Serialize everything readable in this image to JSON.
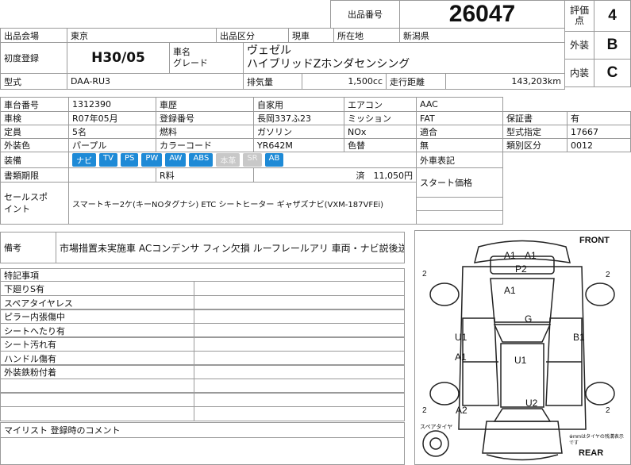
{
  "header": {
    "lot_label": "出品番号",
    "lot_number": "26047",
    "eval_label": "評価点",
    "eval_score": "4",
    "exterior_label": "外装",
    "exterior_grade": "B",
    "interior_label": "内装",
    "interior_grade": "C"
  },
  "row_venue": {
    "venue_label": "出品会場",
    "venue_value": "東京",
    "category_label": "出品区分",
    "category_value": "現車",
    "location_label": "所在地",
    "location_value": "新潟県"
  },
  "row_reg": {
    "first_reg_label": "初度登録",
    "first_reg_value": "H30/05",
    "car_name_label": "車名",
    "grade_label": "グレード",
    "car_name_value": "ヴェゼル",
    "grade_value": "ハイブリッドZホンダセンシング"
  },
  "row_model": {
    "model_label": "型式",
    "model_value": "DAA-RU3",
    "displacement_label": "排気量",
    "displacement_value": "1,500cc",
    "mileage_label": "走行距離",
    "mileage_value": "143,203km"
  },
  "specs": {
    "chassis_label": "車台番号",
    "chassis_value": "1312390",
    "history_label": "車歴",
    "history_value": "自家用",
    "ac_label": "エアコン",
    "ac_value": "AAC",
    "inspection_label": "車検",
    "inspection_value": "R07年05月",
    "plate_label": "登録番号",
    "plate_value": "長岡337ふ23",
    "mission_label": "ミッション",
    "mission_value": "FAT",
    "warranty_label": "保証書",
    "warranty_value": "有",
    "capacity_label": "定員",
    "capacity_value": "5名",
    "fuel_label": "燃料",
    "fuel_value": "ガソリン",
    "nox_label": "NOx",
    "nox_value": "適合",
    "type_cert_label": "型式指定",
    "type_cert_value": "17667",
    "color_label": "外装色",
    "color_value": "パープル",
    "color_code_label": "カラーコード",
    "color_code_value": "YR642M",
    "repaint_label": "色替",
    "repaint_value": "無",
    "class_label": "類別区分",
    "class_value": "0012",
    "equipment_label": "装備",
    "equipment": [
      {
        "name": "ナビ",
        "active": true
      },
      {
        "name": "TV",
        "active": true
      },
      {
        "name": "PS",
        "active": true
      },
      {
        "name": "PW",
        "active": true
      },
      {
        "name": "AW",
        "active": true
      },
      {
        "name": "ABS",
        "active": true
      },
      {
        "name": "本革",
        "active": false
      },
      {
        "name": "SR",
        "active": false
      },
      {
        "name": "AB",
        "active": true
      }
    ],
    "docs_label": "書類期限",
    "recycle_label": "R料",
    "recycle_value": "済　11,050円",
    "outer_notes_label": "外車表記",
    "start_price_label": "スタート価格",
    "sales_label": "セールスポイント",
    "sales_value": "スマートキー2ケ(キーNOタグナシ) ETC シートヒーター ギャザズナビ(VXM-187VFEi)"
  },
  "remarks": {
    "label": "備考",
    "value": "市場措置未実施車 ACコンデンサ フィン欠損 ルーフレールアリ 車両・ナビ説後送"
  },
  "notes": {
    "label": "特記事項",
    "items": [
      "下廻りS有",
      "スペアタイヤレス",
      "ピラー内張傷中",
      "シートへたり有",
      "シート汚れ有",
      "ハンドル傷有",
      "外装鉄粉付着"
    ]
  },
  "mylist": {
    "label": "マイリスト 登録時のコメント"
  },
  "diagram": {
    "front_label": "FRONT",
    "rear_label": "REAR",
    "spare_label": "スペアタイヤ",
    "note": "※mmはタイヤの残溝表示です",
    "marks": [
      "A1",
      "A1",
      "P2",
      "A1",
      "G",
      "U1",
      "B1",
      "A1",
      "U1",
      "U2",
      "A2"
    ],
    "tires": [
      "2",
      "2",
      "2",
      "2"
    ]
  }
}
